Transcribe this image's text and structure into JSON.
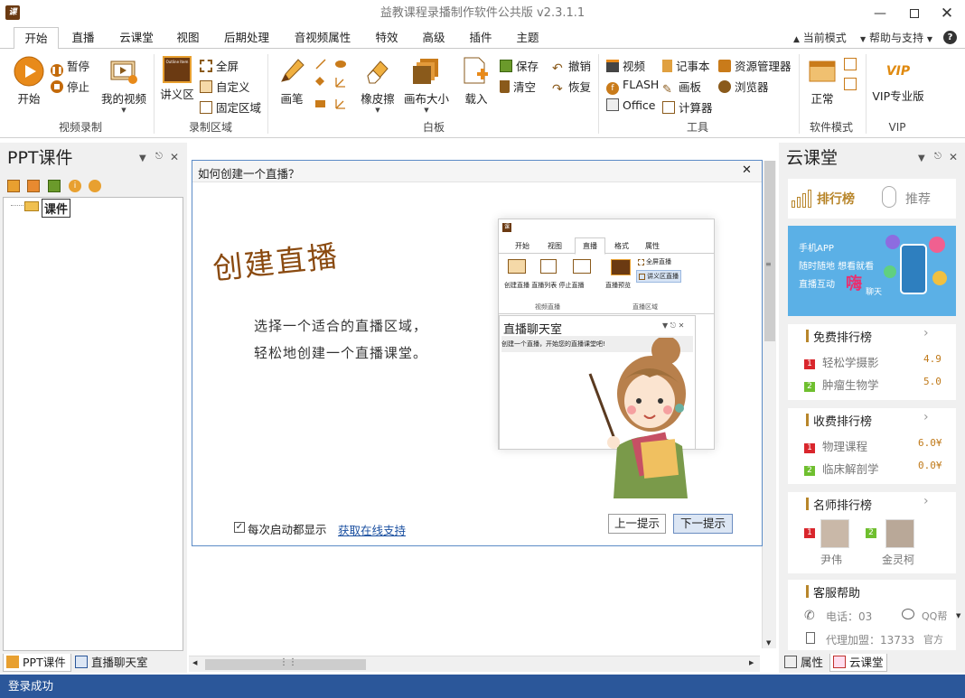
{
  "app": {
    "icon_label": "课",
    "title": "益教课程录播制作软件公共版 v2.3.1.1"
  },
  "tabs": [
    {
      "label": "开始",
      "active": true
    },
    {
      "label": "直播"
    },
    {
      "label": "云课堂"
    },
    {
      "label": "视图"
    },
    {
      "label": "后期处理"
    },
    {
      "label": "音视频属性"
    },
    {
      "label": "特效"
    },
    {
      "label": "高级"
    },
    {
      "label": "插件"
    },
    {
      "label": "主题"
    }
  ],
  "top_right": {
    "mode": "当前模式",
    "help": "帮助与支持"
  },
  "ribbon": {
    "video_record": {
      "label": "视频录制",
      "start": "开始",
      "pause": "暂停",
      "stop": "停止",
      "my_video": "我的视频"
    },
    "record_area": {
      "label": "录制区域",
      "lecture": "讲义区",
      "lecture_thumb": "Outline Item",
      "fullscreen": "全屏",
      "custom": "自定义",
      "fixed": "固定区域"
    },
    "whiteboard": {
      "label": "白板",
      "pen": "画笔",
      "eraser": "橡皮擦",
      "canvas_size": "画布大小",
      "load": "载入",
      "save": "保存",
      "clear": "清空",
      "undo": "撤销",
      "redo": "恢复"
    },
    "tools": {
      "label": "工具",
      "video": "视频",
      "flash": "FLASH",
      "office": "Office",
      "notepad": "记事本",
      "drawing": "画板",
      "calculator": "计算器",
      "explorer": "资源管理器",
      "browser": "浏览器"
    },
    "software_mode": {
      "label": "软件模式",
      "normal": "正常"
    },
    "vip": {
      "label": "VIP",
      "pro": "VIP专业版",
      "logo": "VIP"
    }
  },
  "left_pane": {
    "title": "PPT课件",
    "tree_root": "课件",
    "bottom_tabs": [
      "PPT课件",
      "直播聊天室"
    ]
  },
  "dialog": {
    "title": "如何创建一个直播？",
    "heading": "创建直播",
    "line1": "选择一个适合的直播区域，",
    "line2": "轻松地创建一个直播课堂。",
    "checkbox_label": "每次启动都显示",
    "link": "获取在线支持",
    "prev": "上一提示",
    "next": "下一提示",
    "preview": {
      "icon_label": "课",
      "tabs": [
        "开始",
        "视图",
        "直播",
        "格式",
        "属性"
      ],
      "buttons": [
        "创建直播",
        "直播列表",
        "停止直播",
        "直播预览"
      ],
      "full": "全屏直播",
      "lecture": "讲义区直播",
      "grp1": "视频直播",
      "grp2": "直播区域",
      "chat_title": "直播聊天室",
      "chat_text": "创建一个直播，开始您的直播课堂吧!"
    }
  },
  "right_pane": {
    "title": "云课堂",
    "tab_rank": "排行榜",
    "tab_recommend": "推荐",
    "banner": {
      "l1": "手机APP",
      "l2": "随时随地 想看就看",
      "l3": "直播互动",
      "l4": "嗨",
      "l5": "聊天"
    },
    "free_rank": {
      "title": "免费排行榜",
      "items": [
        {
          "rank": "1",
          "name": "轻松学摄影",
          "value": "4.9"
        },
        {
          "rank": "2",
          "name": "肿瘤生物学",
          "value": "5.0"
        }
      ]
    },
    "paid_rank": {
      "title": "收费排行榜",
      "items": [
        {
          "rank": "1",
          "name": "物理课程",
          "value": "6.0¥"
        },
        {
          "rank": "2",
          "name": "临床解剖学",
          "value": "0.0¥"
        }
      ]
    },
    "teacher_rank": {
      "title": "名师排行榜",
      "items": [
        {
          "rank": "1",
          "name": "尹伟"
        },
        {
          "rank": "2",
          "name": "金灵柯"
        }
      ]
    },
    "support": {
      "title": "客服帮助",
      "phone": "电话：03",
      "agent": "代理加盟：13733",
      "qq": "QQ帮",
      "official": "官方"
    },
    "bottom_tabs": [
      "属性",
      "云课堂"
    ]
  },
  "status": "登录成功",
  "colors": {
    "accent": "#2b579a",
    "rank1": "#d9262c",
    "rank2": "#6fbf2f",
    "gold": "#b8862b"
  }
}
